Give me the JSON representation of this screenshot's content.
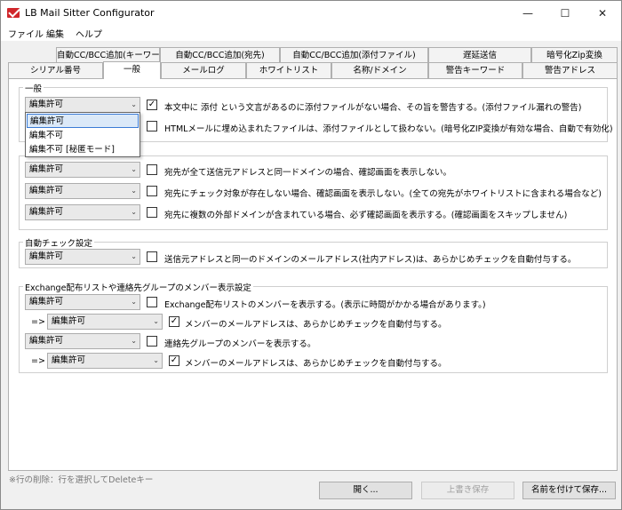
{
  "window": {
    "title": "LB Mail Sitter Configurator"
  },
  "menu": {
    "file": "ファイル",
    "edit": "編集",
    "help": "ヘルプ"
  },
  "tabs_row1": [
    "自動CC/BCC追加(キーワード)",
    "自動CC/BCC追加(宛先)",
    "自動CC/BCC追加(添付ファイル)",
    "遅延送信",
    "暗号化Zip変換"
  ],
  "tabs_row2": [
    "シリアル番号",
    "一般",
    "メールログ",
    "ホワイトリスト",
    "名称/ドメイン",
    "警告キーワード",
    "警告アドレス"
  ],
  "group_general": {
    "title": "一般",
    "row1": {
      "combo": "編集許可",
      "checked": true,
      "text": "本文中に 添付 という文言があるのに添付ファイルがない場合、その旨を警告する。(添付ファイル漏れの警告)"
    },
    "row2": {
      "checked": false,
      "text": "HTMLメールに埋め込まれたファイルは、添付ファイルとして扱わない。(暗号化ZIP変換が有効な場合、自動で有効化)"
    }
  },
  "dropdown_options": [
    "編集許可",
    "編集不可",
    "編集不可 [秘匿モード]"
  ],
  "group_confirm": {
    "rows": [
      {
        "combo": "編集許可",
        "checked": false,
        "text": "宛先が全て送信元アドレスと同一ドメインの場合、確認画面を表示しない。"
      },
      {
        "combo": "編集許可",
        "checked": false,
        "text": "宛先にチェック対象が存在しない場合、確認画面を表示しない。(全ての宛先がホワイトリストに含まれる場合など)"
      },
      {
        "combo": "編集許可",
        "checked": false,
        "text": "宛先に複数の外部ドメインが含まれている場合、必ず確認画面を表示する。(確認画面をスキップしません)"
      }
    ]
  },
  "group_autocheck": {
    "title": "自動チェック設定",
    "row": {
      "combo": "編集許可",
      "checked": false,
      "text": "送信元アドレスと同一のドメインのメールアドレス(社内アドレス)は、あらかじめチェックを自動付与する。"
    }
  },
  "group_exchange": {
    "title": "Exchange配布リストや連絡先グループのメンバー表示設定",
    "row1": {
      "combo": "編集許可",
      "checked": false,
      "text": "Exchange配布リストのメンバーを表示する。(表示に時間がかかる場合があります。)"
    },
    "row1_sub": {
      "prefix": "=>",
      "combo": "編集許可",
      "checked": true,
      "text": "メンバーのメールアドレスは、あらかじめチェックを自動付与する。"
    },
    "row2": {
      "combo": "編集許可",
      "checked": false,
      "text": "連絡先グループのメンバーを表示する。"
    },
    "row2_sub": {
      "prefix": "=>",
      "combo": "編集許可",
      "checked": true,
      "text": "メンバーのメールアドレスは、あらかじめチェックを自動付与する。"
    }
  },
  "footer": {
    "hint": "※行の削除：行を選択してDeleteキー",
    "open": "開く...",
    "overwrite": "上書き保存",
    "save_as": "名前を付けて保存..."
  }
}
